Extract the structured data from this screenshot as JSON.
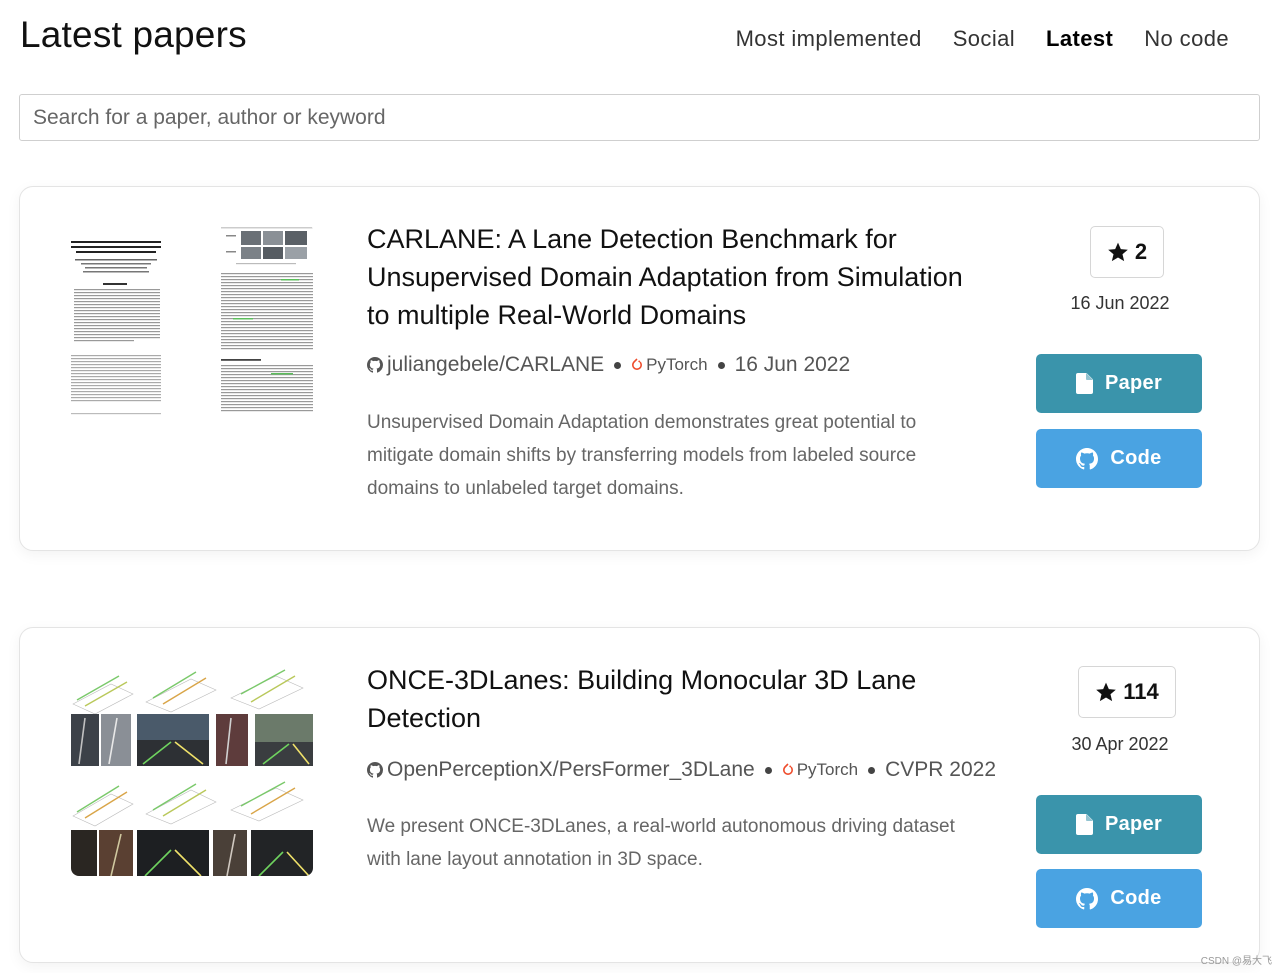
{
  "header": {
    "title": "Latest papers",
    "nav": [
      "Most implemented",
      "Social",
      "Latest",
      "No code"
    ],
    "active": "Latest"
  },
  "search": {
    "placeholder": "Search for a paper, author or keyword"
  },
  "papers": [
    {
      "title": "CARLANE: A Lane Detection Benchmark for Unsupervised Domain Adaptation from Simulation to multiple Real-World Domains",
      "repo": "juliangebele/CARLANE",
      "framework": "PyTorch",
      "venue": "16 Jun 2022",
      "abstract": "Unsupervised Domain Adaptation demonstrates great potential to mitigate domain shifts by transferring models from labeled source domains to unlabeled target domains.",
      "stars": "2",
      "date": "16 Jun 2022",
      "paper_label": "Paper",
      "code_label": "Code"
    },
    {
      "title": "ONCE-3DLanes: Building Monocular 3D Lane Detection",
      "repo": "OpenPerceptionX/PersFormer_3DLane",
      "framework": "PyTorch",
      "venue": "CVPR 2022",
      "abstract": "We present ONCE-3DLanes, a real-world autonomous driving dataset with lane layout annotation in 3D space.",
      "stars": "114",
      "date": "30 Apr 2022",
      "paper_label": "Paper",
      "code_label": "Code"
    }
  ],
  "watermark": "CSDN @易大飞",
  "colors": {
    "paper_button": "#3a94ab",
    "code_button": "#4aa3e2",
    "pytorch": "#ee4c2c"
  },
  "icons": [
    "star-icon",
    "github-icon",
    "pytorch-icon",
    "document-icon"
  ]
}
